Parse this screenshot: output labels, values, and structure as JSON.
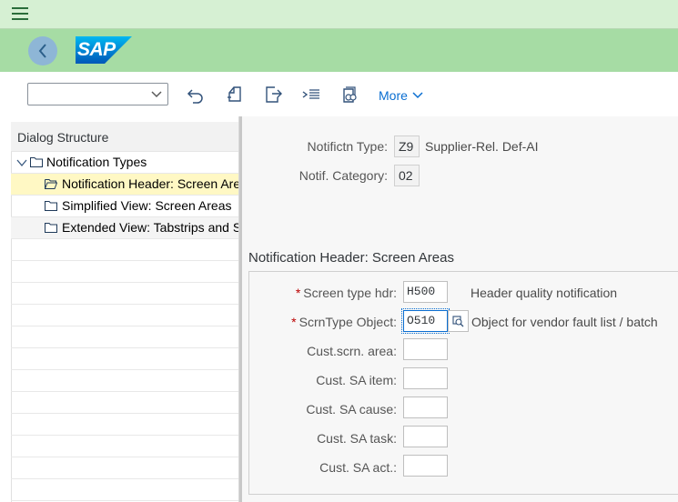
{
  "shell": {
    "menu_icon": "hamburger-menu-icon",
    "back_icon": "chevron-left-icon",
    "logo_text": "SAP"
  },
  "toolbar": {
    "command_field_value": "",
    "icons": [
      "undo-icon",
      "copy-as-icon",
      "export-icon",
      "select-all-icon",
      "other-view-icon"
    ],
    "more_label": "More"
  },
  "dialog_structure": {
    "title": "Dialog Structure",
    "items": [
      {
        "label": "Notification Types",
        "level": 0,
        "expanded": true
      },
      {
        "label": "Notification Header: Screen Areas",
        "level": 1,
        "selected": true
      },
      {
        "label": "Simplified View: Screen Areas",
        "level": 1
      },
      {
        "label": "Extended View: Tabstrips and Screens",
        "level": 1
      }
    ]
  },
  "header_fields": {
    "notif_type_label": "Notifictn Type:",
    "notif_type_value": "Z9",
    "notif_type_desc": "Supplier-Rel. Def-AI",
    "notif_category_label": "Notif. Category:",
    "notif_category_value": "02"
  },
  "section": {
    "title": "Notification Header: Screen Areas",
    "fields": [
      {
        "label": "Screen type hdr:",
        "required": true,
        "value": "H500",
        "desc": "Header quality notification"
      },
      {
        "label": "ScrnType Object:",
        "required": true,
        "value": "O510",
        "desc": "Object for vendor fault list / batch"
      },
      {
        "label": "Cust.scrn. area:",
        "required": false,
        "value": "",
        "desc": ""
      },
      {
        "label": "Cust. SA item:",
        "required": false,
        "value": "",
        "desc": ""
      },
      {
        "label": "Cust. SA cause:",
        "required": false,
        "value": "",
        "desc": ""
      },
      {
        "label": "Cust. SA task:",
        "required": false,
        "value": "",
        "desc": ""
      },
      {
        "label": "Cust. SA act.:",
        "required": false,
        "value": "",
        "desc": ""
      }
    ]
  },
  "colors": {
    "topbar": "#d6f0d3",
    "shellbar": "#a6dca4",
    "accent": "#0a6ed1",
    "selected_row": "#fff8c4",
    "required": "#bb0000"
  }
}
